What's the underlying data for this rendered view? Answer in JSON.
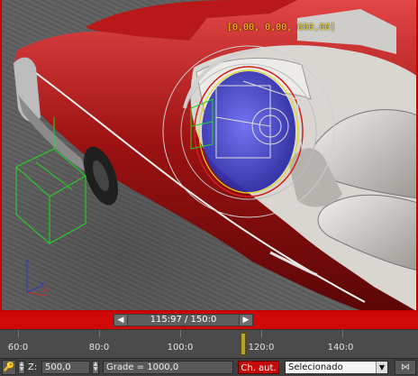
{
  "viewport": {
    "coord_readout": "[0,00, 0,00, 600,00]",
    "axis": {
      "x": "X",
      "y": "Y",
      "z": "Z"
    }
  },
  "timeline": {
    "frame_label": "115:97 / 150:0",
    "prev_icon": "triangle-left-icon",
    "next_icon": "triangle-right-icon",
    "current_frame": 115.97,
    "total_frames": 150,
    "ruler_labels": [
      "60:0",
      "80:0",
      "100:0",
      "120:0",
      "140:0"
    ]
  },
  "status": {
    "z_label": "Z:",
    "z_value": "500,0",
    "grid_label": "Grade = 1000,0",
    "auto_key_label": "Ch. aut.",
    "selection_value": "Selecionado",
    "key_filter_icon": "key-filter-icon",
    "left_icon": "key-icon"
  },
  "colors": {
    "timebar": "#d10808",
    "auto_key": "#c50a0a",
    "coord_text": "#f3d400",
    "gizmo_fill": "#3b3bd8"
  }
}
